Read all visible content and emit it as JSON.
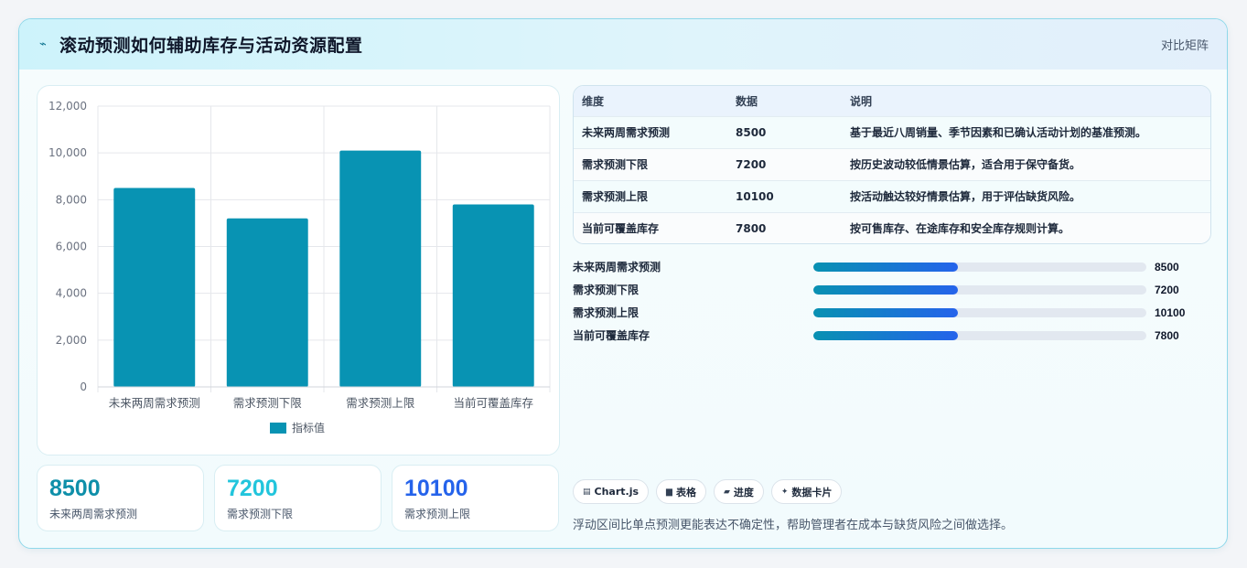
{
  "header": {
    "icon": "trend-icon",
    "title": "滚动预测如何辅助库存与活动资源配置",
    "tag": "对比矩阵"
  },
  "chart_data": {
    "type": "bar",
    "categories": [
      "未来两周需求预测",
      "需求预测下限",
      "需求预测上限",
      "当前可覆盖库存"
    ],
    "series": [
      {
        "name": "指标值",
        "values": [
          8500,
          7200,
          10100,
          7800
        ],
        "color": "#0893b3"
      }
    ],
    "ylim": [
      0,
      12000
    ],
    "yticks": [
      "12,000",
      "10,000",
      "8,000",
      "6,000",
      "4,000",
      "2,000",
      "0"
    ],
    "grid": true,
    "legend": "bottom"
  },
  "kpis": [
    {
      "value": "8500",
      "label": "未来两周需求预测",
      "color": "#0e8fa9"
    },
    {
      "value": "7200",
      "label": "需求预测下限",
      "color": "#22c5dc"
    },
    {
      "value": "10100",
      "label": "需求预测上限",
      "color": "#2563eb"
    }
  ],
  "table": {
    "headers": [
      "维度",
      "数据",
      "说明"
    ],
    "rows": [
      [
        "未来两周需求预测",
        "8500",
        "基于最近八周销量、季节因素和已确认活动计划的基准预测。"
      ],
      [
        "需求预测下限",
        "7200",
        "按历史波动较低情景估算，适合用于保守备货。"
      ],
      [
        "需求预测上限",
        "10100",
        "按活动触达较好情景估算，用于评估缺货风险。"
      ],
      [
        "当前可覆盖库存",
        "7800",
        "按可售库存、在途库存和安全库存规则计算。"
      ]
    ]
  },
  "progress": [
    {
      "label": "未来两周需求预测",
      "value": "8500",
      "fraction": 0.435
    },
    {
      "label": "需求预测下限",
      "value": "7200",
      "fraction": 0.435
    },
    {
      "label": "需求预测上限",
      "value": "10100",
      "fraction": 0.435
    },
    {
      "label": "当前可覆盖库存",
      "value": "7800",
      "fraction": 0.435
    }
  ],
  "chips": [
    {
      "icon": "chart-icon",
      "glyph": "▤",
      "label": "Chart.js"
    },
    {
      "icon": "table-icon",
      "glyph": "▆",
      "label": "表格"
    },
    {
      "icon": "progress-icon",
      "glyph": "▰",
      "label": "进度"
    },
    {
      "icon": "sparkle-icon",
      "glyph": "✦",
      "label": "数据卡片"
    }
  ],
  "footnote": "浮动区间比单点预测更能表达不确定性，帮助管理者在成本与缺货风险之间做选择。"
}
